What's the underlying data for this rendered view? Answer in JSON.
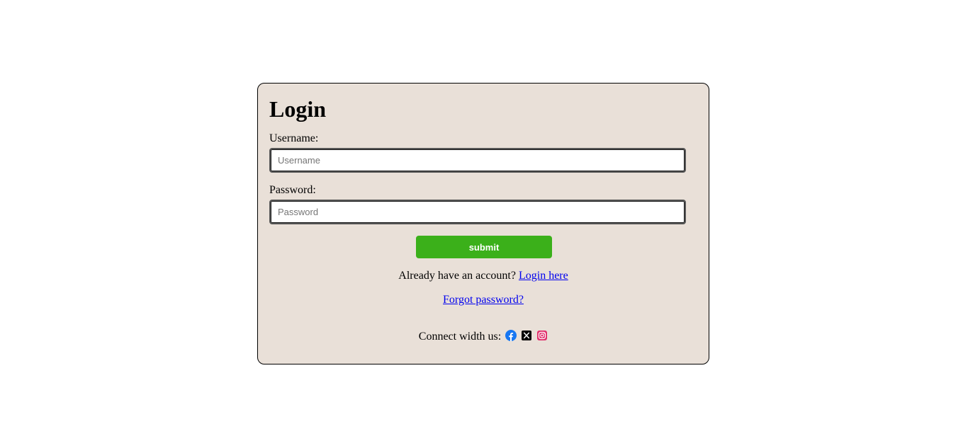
{
  "login": {
    "title": "Login",
    "username": {
      "label": "Username:",
      "placeholder": "Username",
      "value": ""
    },
    "password": {
      "label": "Password:",
      "placeholder": "Password",
      "value": ""
    },
    "submit_label": "submit",
    "account_prompt": "Already have an account?",
    "login_link": "Login here",
    "forgot_link": "Forgot password?",
    "connect_label": "Connect width us:",
    "social_icons": [
      "facebook-icon",
      "x-twitter-icon",
      "instagram-icon"
    ]
  },
  "colors": {
    "card_background": "#e9e0d8",
    "submit_button": "#3bb01a",
    "link": "#0000ee",
    "facebook": "#1877f2",
    "x": "#000000",
    "instagram": "#e1306c"
  }
}
